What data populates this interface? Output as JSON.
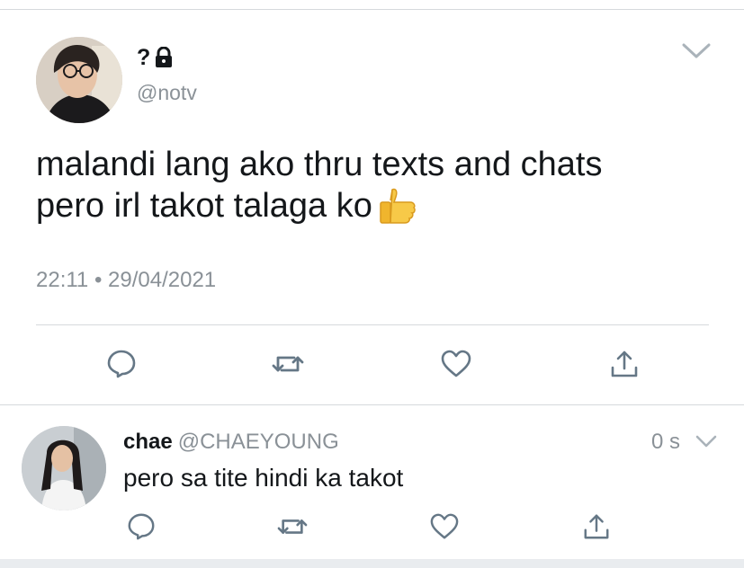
{
  "tweet": {
    "display_name": "?",
    "handle": "@notv",
    "text_lines": [
      "malandi lang ako thru texts and chats",
      "pero irl takot talaga ko"
    ],
    "time": "22:11",
    "separator": "•",
    "date": "29/04/2021",
    "icons": {
      "lock": "lock-icon",
      "emoji": "thumbs-up-emoji",
      "menu": "chevron-down-icon"
    }
  },
  "actions": [
    "reply-icon",
    "retweet-icon",
    "like-icon",
    "share-icon"
  ],
  "reply": {
    "display_name": "chae",
    "handle": "@CHAEYOUNG",
    "age": "0 s",
    "text": "pero sa tite hindi ka takot"
  },
  "colors": {
    "text": "#14171a",
    "muted": "#8a9197",
    "divider": "#d6d9dc",
    "icon": "#657786"
  }
}
